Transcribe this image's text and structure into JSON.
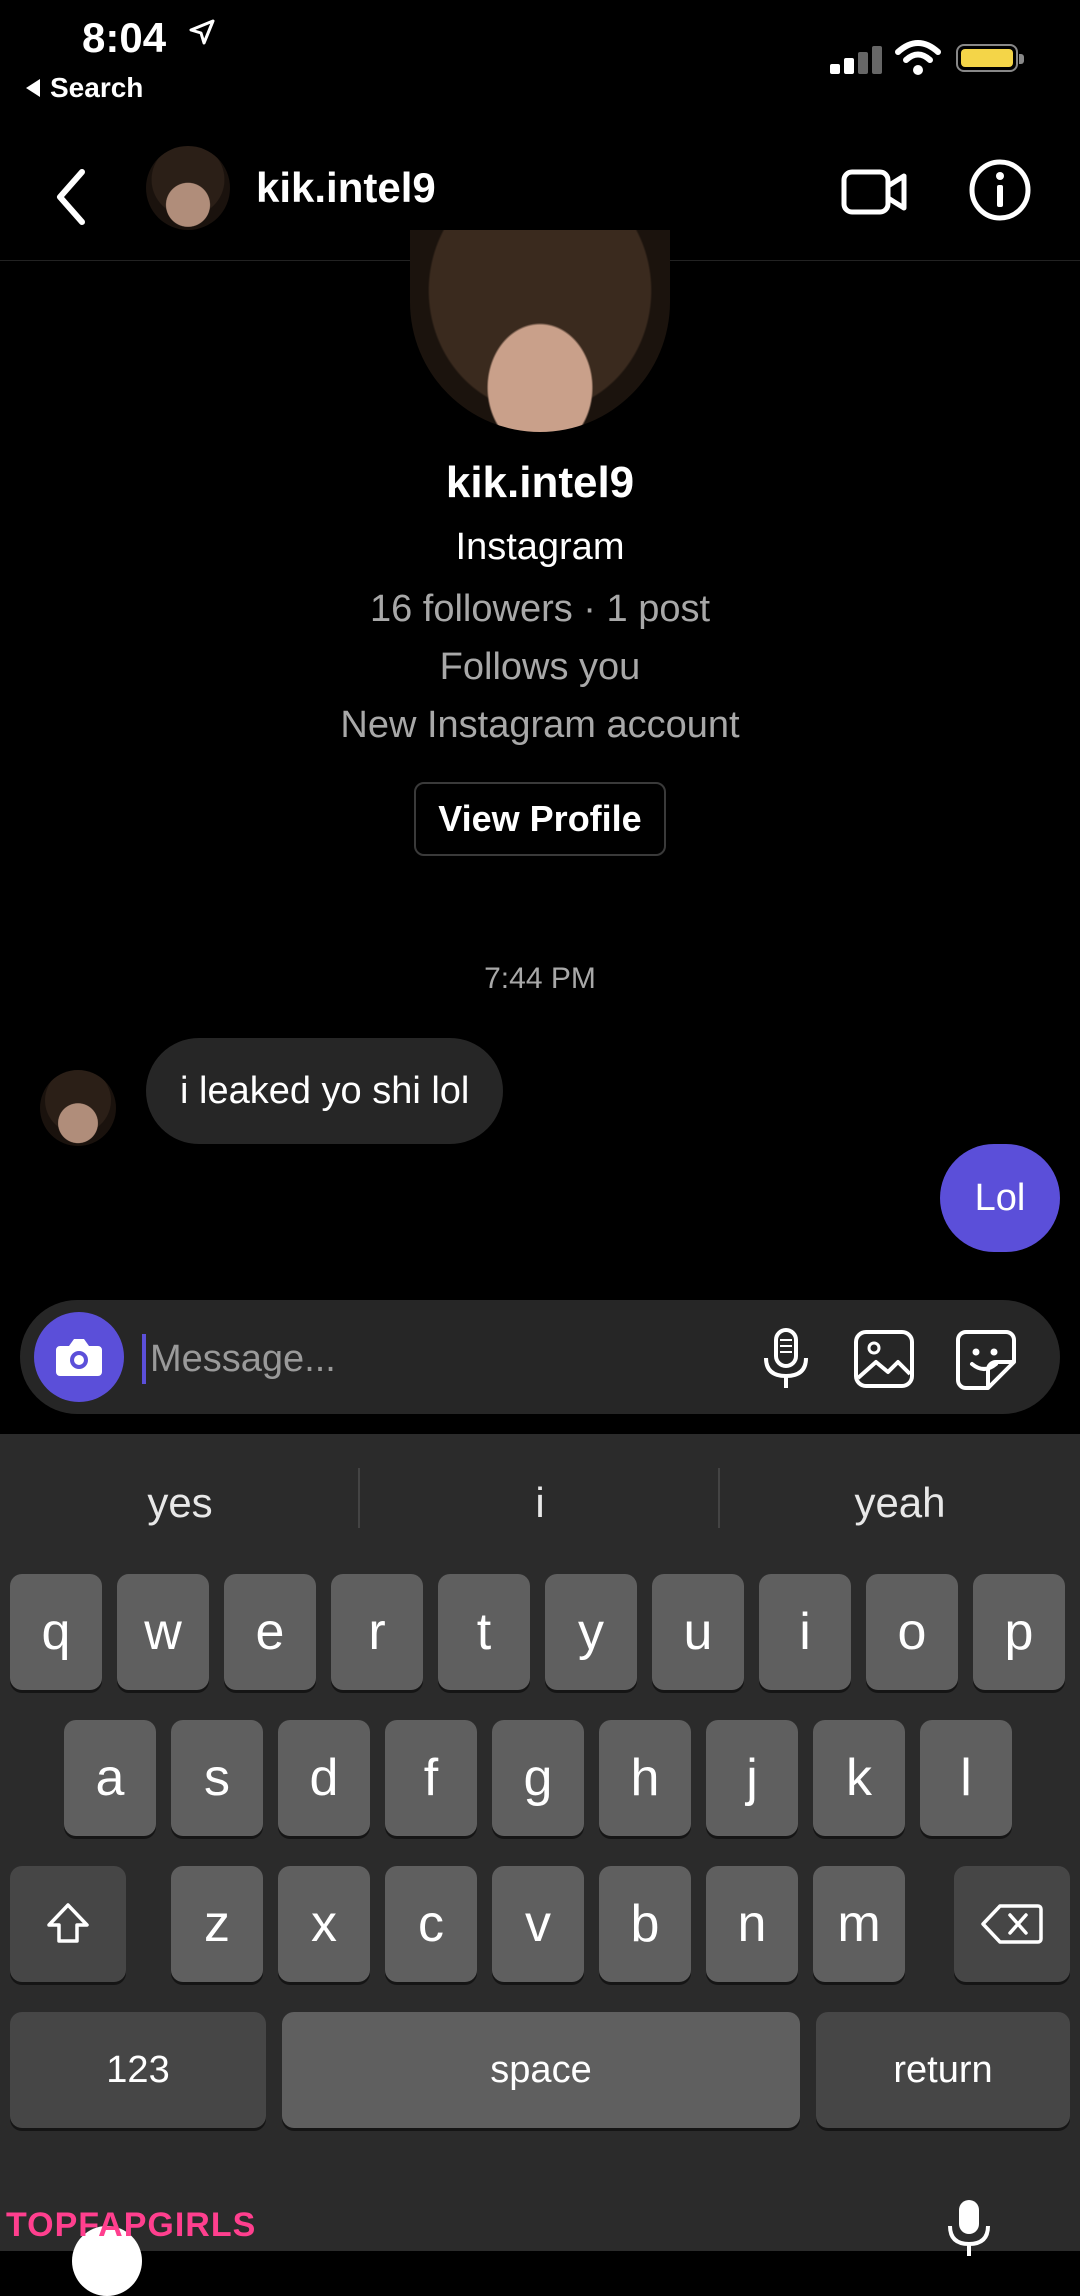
{
  "status_bar": {
    "time": "8:04",
    "back_app": "Search"
  },
  "header": {
    "username": "kik.intel9"
  },
  "profile": {
    "name": "kik.intel9",
    "platform": "Instagram",
    "stats": "16 followers · 1 post",
    "follows": "Follows you",
    "account_note": "New Instagram account",
    "view_profile_label": "View Profile"
  },
  "chat": {
    "timestamp": "7:44 PM",
    "messages": [
      {
        "direction": "incoming",
        "text": "i leaked yo shi lol"
      },
      {
        "direction": "outgoing",
        "text": "Lol"
      }
    ]
  },
  "composer": {
    "placeholder": "Message..."
  },
  "keyboard": {
    "suggestions": [
      "yes",
      "i",
      "yeah"
    ],
    "row1": [
      "q",
      "w",
      "e",
      "r",
      "t",
      "y",
      "u",
      "i",
      "o",
      "p"
    ],
    "row2": [
      "a",
      "s",
      "d",
      "f",
      "g",
      "h",
      "j",
      "k",
      "l"
    ],
    "row3": [
      "z",
      "x",
      "c",
      "v",
      "b",
      "n",
      "m"
    ],
    "numbers_label": "123",
    "space_label": "space",
    "return_label": "return"
  },
  "watermark": "TOPFAPGIRLS",
  "colors": {
    "accent": "#5b4fd9",
    "bubble_in": "#262626",
    "battery": "#f4d548"
  }
}
